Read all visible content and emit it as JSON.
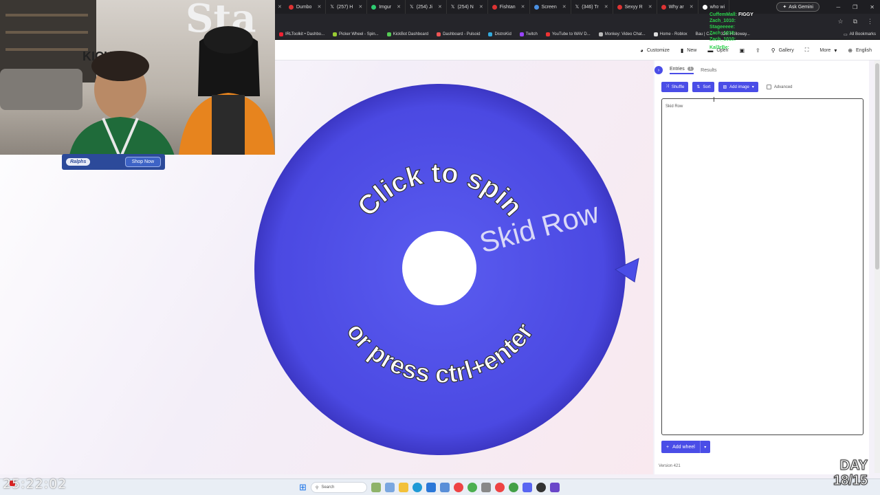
{
  "browser": {
    "tabs": [
      "Dumbo",
      "(257) H",
      "Imgur",
      "(254) Ji",
      "(254) N",
      "Fishtan",
      "Screen",
      "(346) Tr",
      "Sexyy R",
      "Why ar",
      "who wi"
    ],
    "ask_gemini": "Ask Gemini",
    "bookmarks": [
      "IRLToolkit • Dashbo...",
      "Picker Wheel - Spin...",
      "KickBot Dashboard",
      "Dashboard - Pulsoid",
      "DistroKid",
      "Twitch",
      "YouTube to WAV D...",
      "Monkey: Video Chat...",
      "Home - Roblox",
      "Bau | C...",
      "326: Holloway..."
    ],
    "all_bookmarks": "All Bookmarks"
  },
  "toolbar": {
    "customize": "Customize",
    "new": "New",
    "open": "Open",
    "gallery": "Gallery",
    "more": "More",
    "language": "English"
  },
  "stream": {
    "sign_top": "Sta",
    "sign_kick": "KICK",
    "ad_logo": "Ralphs",
    "ad_button": "Shop Now",
    "timer": "25:22:02",
    "day_line1": "DAY",
    "day_line2": "18/15"
  },
  "chat": [
    {
      "user": "CuffemMall:",
      "text": "FIGGY",
      "color": "#2bd14b"
    },
    {
      "user": "Zach_1010:",
      "text": "",
      "color": "#2bd14b"
    },
    {
      "user": "Stageeeee:",
      "text": "",
      "color": "#2bd14b"
    },
    {
      "user": "Zach_1010:",
      "text": "",
      "color": "#2bd14b"
    },
    {
      "user": "Zach_1010:",
      "text": "",
      "color": "#2bd14b"
    },
    {
      "user": "Kal3rBe:",
      "text": "",
      "color": "#2bd14b"
    }
  ],
  "wheel": {
    "top_text": "Click to spin",
    "bottom_text": "or press ctrl+enter",
    "entry": "Skid Row",
    "color": "#4a4ae0"
  },
  "panel": {
    "tab_entries": "Entries",
    "entries_count": "1",
    "tab_results": "Results",
    "shuffle": "Shuffle",
    "sort": "Sort",
    "add_image": "Add image",
    "advanced": "Advanced",
    "entries_text": "Skid Row",
    "add_wheel": "Add wheel",
    "version": "Version 421"
  },
  "taskbar": {
    "search": "Search"
  },
  "colors": {
    "accent": "#4a4de7",
    "chat_green": "#2bd14b"
  }
}
